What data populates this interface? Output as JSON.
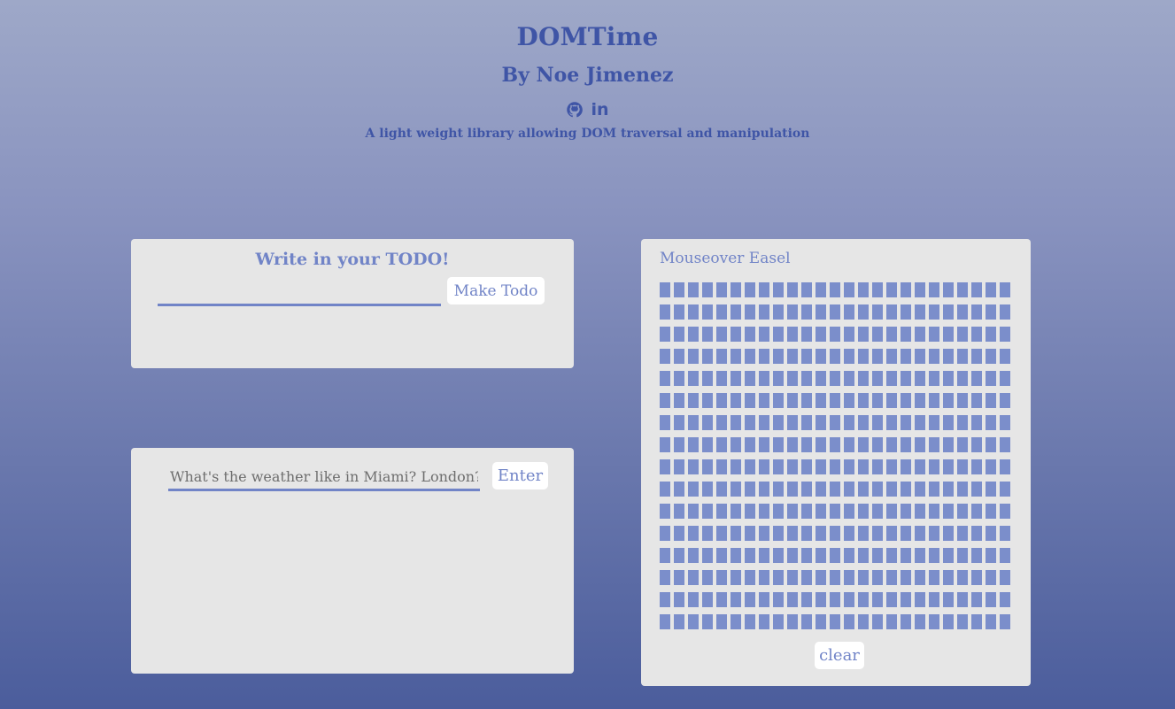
{
  "header": {
    "title": "DOMTime",
    "author": "By Noe Jimenez",
    "social": [
      {
        "name": "github",
        "icon": "github-icon"
      },
      {
        "name": "linkedin",
        "icon": "linkedin-icon",
        "text": "in"
      }
    ],
    "tagline": "A light weight library allowing DOM traversal and manipulation"
  },
  "todo": {
    "heading": "Write in your TODO!",
    "input_value": "",
    "button_label": "Make Todo"
  },
  "weather": {
    "placeholder": "What's the weather like in Miami? London?",
    "button_label": "Enter"
  },
  "easel": {
    "heading": "Mouseover Easel",
    "rows": 16,
    "cols": 25,
    "cell_color": "#7b8ecb",
    "clear_label": "clear"
  },
  "colors": {
    "accent": "#3f55a6",
    "muted_accent": "#7184c7",
    "panel": "#e6e6e6"
  }
}
